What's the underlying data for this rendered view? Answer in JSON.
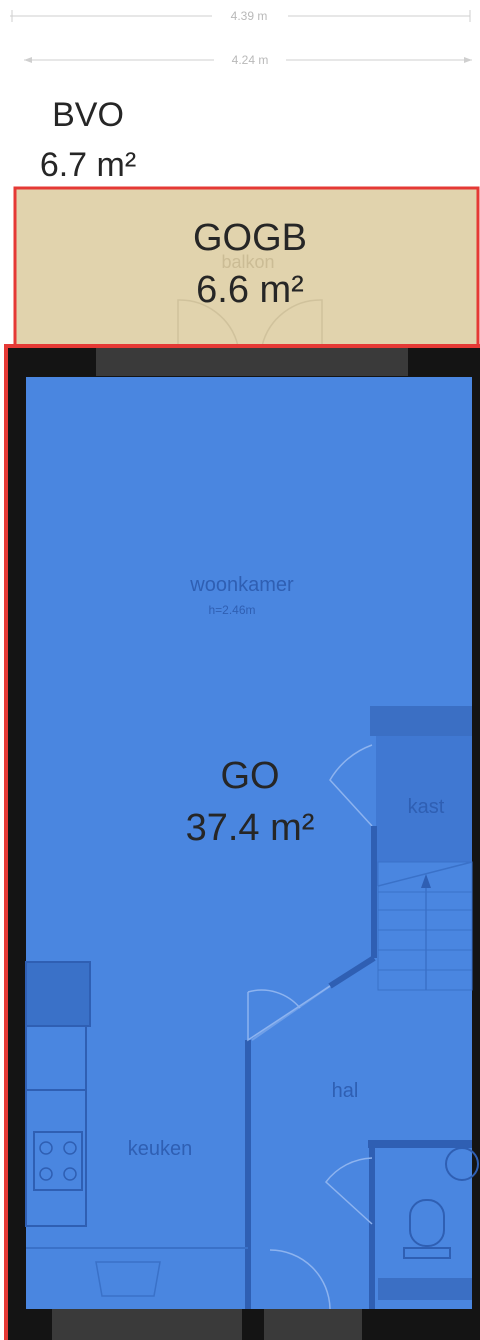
{
  "dimensions": {
    "outer_width": "4.39 m",
    "inner_width": "4.24 m"
  },
  "bvo": {
    "label": "BVO",
    "area": "6.7 m²"
  },
  "gogb": {
    "label": "GOGB",
    "area": "6.6 m²",
    "fill_color": "#e1d3ad",
    "outline_color": "#e53935"
  },
  "go": {
    "label": "GO",
    "area": "37.4 m²",
    "fill_color": "#4a86e0",
    "outline_color": "#e53935"
  },
  "rooms": {
    "balcony": "balkon",
    "living": "woonkamer",
    "living_height": "h=2.46m",
    "closet": "kast",
    "hall": "hal",
    "kitchen": "keuken"
  },
  "icons": {
    "stairs": "stairs-icon",
    "stove": "stove-icon",
    "sink": "sink-icon",
    "toilet": "toilet-icon"
  }
}
